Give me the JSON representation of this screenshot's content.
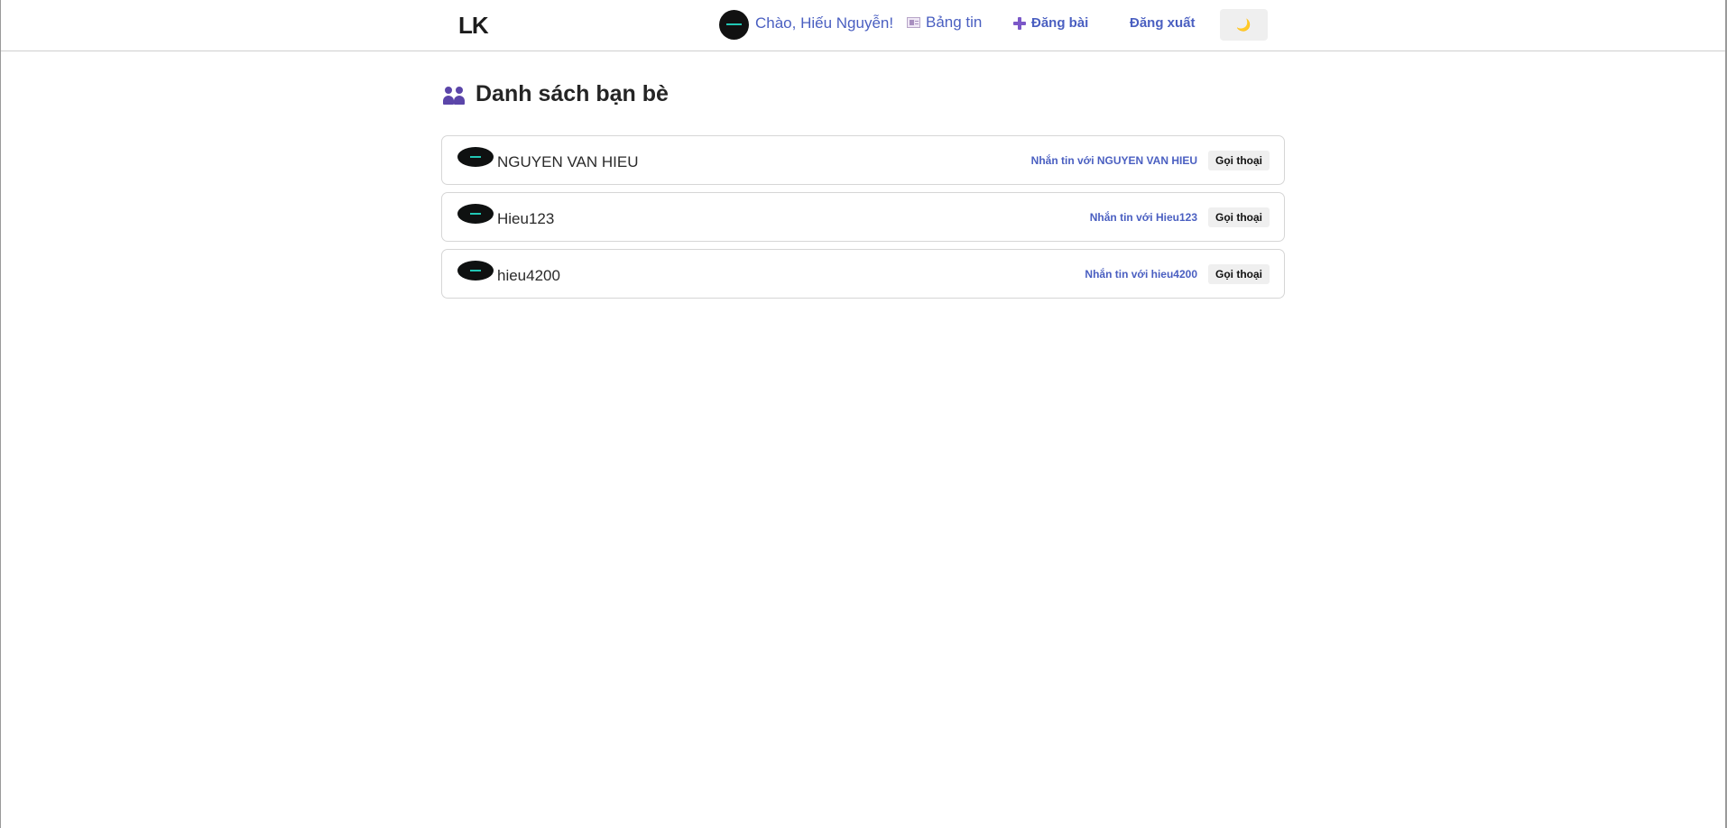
{
  "header": {
    "logo": "LK",
    "greeting": "Chào, Hiếu Nguyễn!",
    "nav": {
      "newsfeed_label": "Bảng tin",
      "newsfeed_icon": "newspaper-icon",
      "post_label": "Đăng bài",
      "post_icon": "plus-icon",
      "logout_label": "Đăng xuất"
    },
    "theme_toggle_icon": "moon-icon",
    "theme_toggle_glyph": "🌙"
  },
  "page": {
    "title": "Danh sách bạn bè",
    "title_icon": "friends-icon"
  },
  "friends": [
    {
      "name": "NGUYEN VAN HIEU",
      "message_label": "Nhắn tin với NGUYEN VAN HIEU",
      "call_label": "Gọi thoại"
    },
    {
      "name": "Hieu123",
      "message_label": "Nhắn tin với Hieu123",
      "call_label": "Gọi thoại"
    },
    {
      "name": "hieu4200",
      "message_label": "Nhắn tin với hieu4200",
      "call_label": "Gọi thoại"
    }
  ],
  "colors": {
    "link": "#4a5fc1",
    "accent_purple": "#5b45a9",
    "avatar_bg": "#111111",
    "avatar_accent": "#21c7b4",
    "button_bg": "#efefef",
    "border": "#d6d6d6"
  }
}
